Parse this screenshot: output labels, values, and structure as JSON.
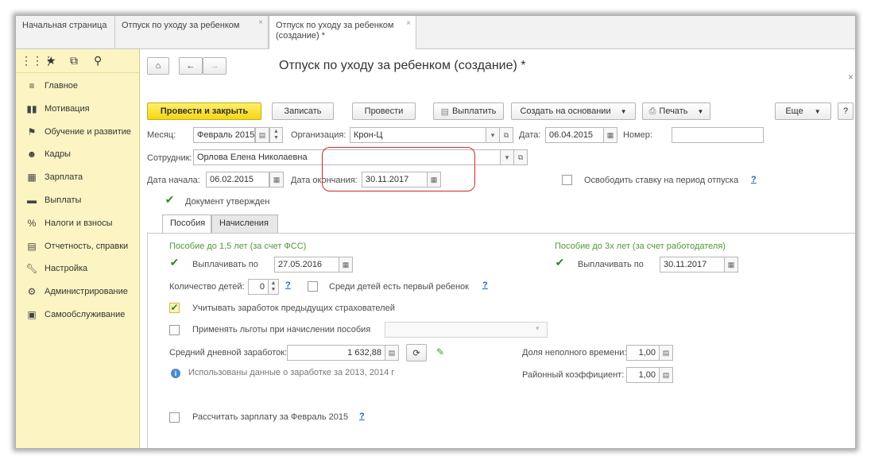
{
  "tabs": [
    {
      "label": "Начальная страница"
    },
    {
      "label": "Отпуск по уходу за ребенком"
    },
    {
      "label": "Отпуск по уходу за ребенком (создание) *"
    }
  ],
  "sidebar": {
    "tool_icons": [
      "apps-grid-icon",
      "star-icon",
      "history-icon",
      "search-icon"
    ],
    "items": [
      {
        "label": "Главное",
        "icon": "menu-icon"
      },
      {
        "label": "Мотивация",
        "icon": "motivation-icon"
      },
      {
        "label": "Обучение и развитие",
        "icon": "education-icon"
      },
      {
        "label": "Кадры",
        "icon": "people-icon"
      },
      {
        "label": "Зарплата",
        "icon": "calculator-icon"
      },
      {
        "label": "Выплаты",
        "icon": "card-icon"
      },
      {
        "label": "Налоги и взносы",
        "icon": "percent-icon"
      },
      {
        "label": "Отчетность, справки",
        "icon": "report-icon"
      },
      {
        "label": "Настройка",
        "icon": "wrench-icon"
      },
      {
        "label": "Администрирование",
        "icon": "gear-icon"
      },
      {
        "label": "Самообслуживание",
        "icon": "self-service-icon"
      }
    ]
  },
  "header": {
    "title": "Отпуск по уходу за ребенком (создание) *"
  },
  "toolbar": {
    "post_close": "Провести и закрыть",
    "save": "Записать",
    "post": "Провести",
    "pay": "Выплатить",
    "create_based": "Создать на основании",
    "print": "Печать",
    "more": "Еще",
    "help": "?"
  },
  "form": {
    "month_label": "Месяц:",
    "month_value": "Февраль 2015",
    "org_label": "Организация:",
    "org_value": "Крон-Ц",
    "date_label": "Дата:",
    "date_value": "06.04.2015",
    "number_label": "Номер:",
    "number_value": "",
    "employee_label": "Сотрудник:",
    "employee_value": "Орлова Елена Николаевна",
    "start_label": "Дата начала:",
    "start_value": "06.02.2015",
    "end_label": "Дата окончания:",
    "end_value": "30.11.2017",
    "release_rate_label": "Освободить ставку на период отпуска",
    "approved_label": "Документ утвержден",
    "help_q": "?"
  },
  "inner_tabs": [
    "Пособия",
    "Начисления"
  ],
  "benefits": {
    "fss_title": "Пособие до 1,5 лет (за счет ФСС)",
    "pay_until_label": "Выплачивать по",
    "pay_until_value": "27.05.2016",
    "employer_title": "Пособие до 3х лет (за счет работодателя)",
    "pay_until2_label": "Выплачивать по",
    "pay_until2_value": "30.11.2017",
    "children_label": "Количество детей:",
    "children_value": "0",
    "first_child_label": "Среди детей есть первый ребенок",
    "prev_insurers_label": "Учитывать заработок предыдущих страхователей",
    "apply_benefits_label": "Применять льготы при начислении пособия",
    "avg_daily_label": "Средний дневной заработок:",
    "avg_daily_value": "1 632,88",
    "part_time_label": "Доля неполного времени:",
    "part_time_value": "1,00",
    "regional_label": "Районный коэффициент:",
    "regional_value": "1,00",
    "info_text": "Использованы данные о заработке за  2013,  2014 г",
    "calc_salary_label": "Рассчитать зарплату за Февраль 2015",
    "help_q": "?"
  }
}
